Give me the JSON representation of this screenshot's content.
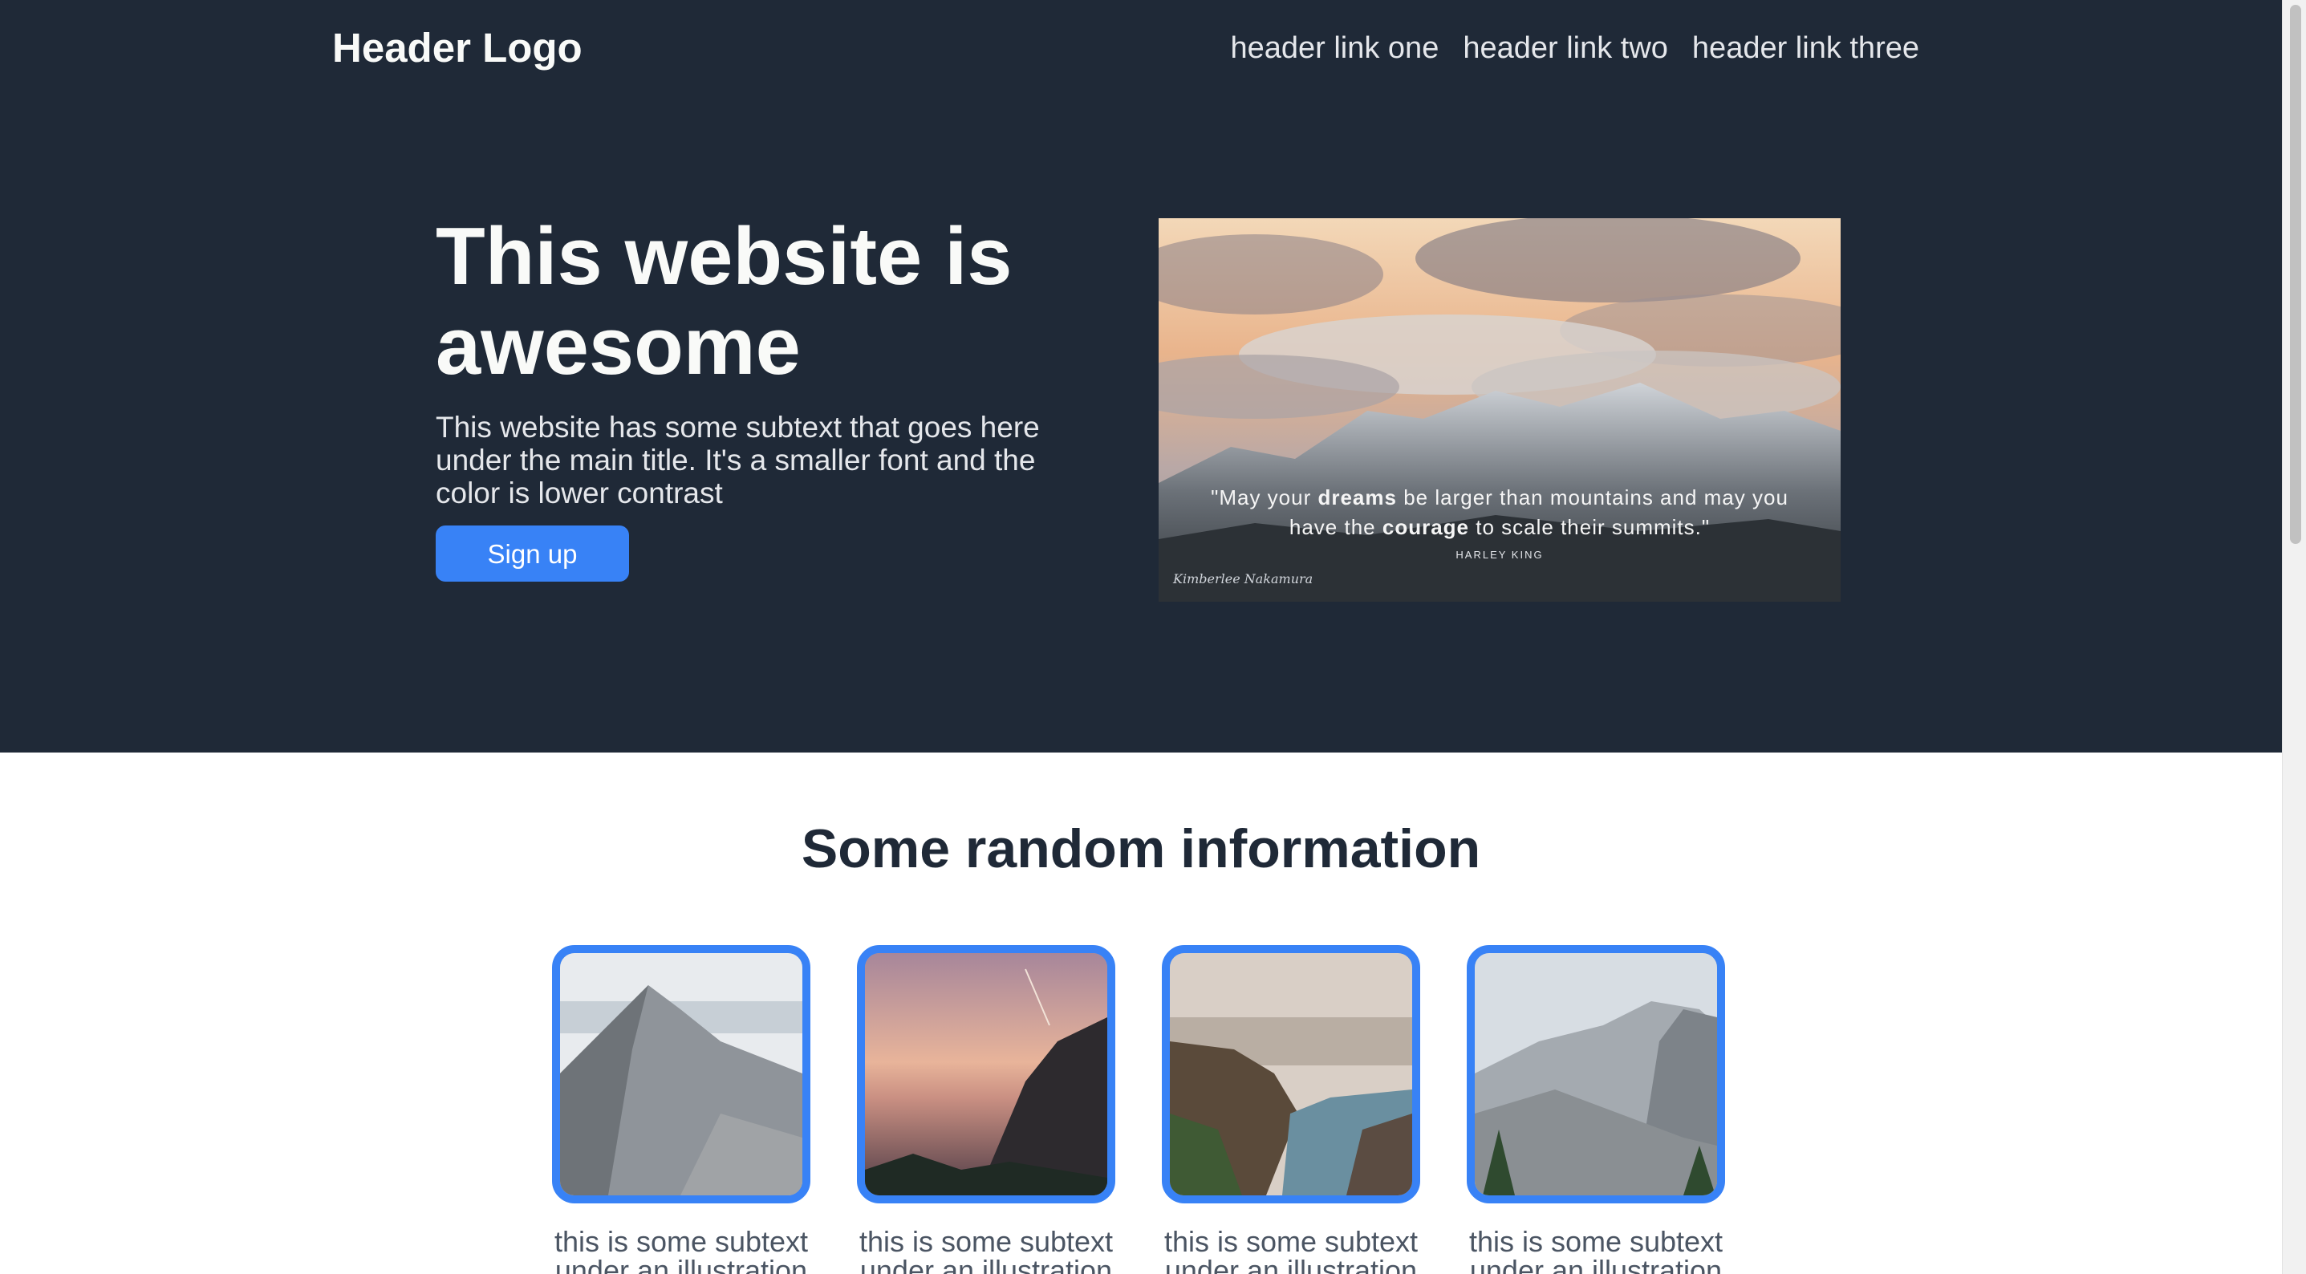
{
  "header": {
    "logo": "Header Logo",
    "links": [
      "header link one",
      "header link two",
      "header link three"
    ]
  },
  "hero": {
    "title": "This website is awesome",
    "subtext": "This website has some subtext that goes here under the main title. It's a smaller font and the color is lower contrast",
    "button_label": "Sign up",
    "image": {
      "quote_part1": "\"May your ",
      "quote_bold1": "dreams",
      "quote_part2": " be larger than mountains and may you have the ",
      "quote_bold2": "courage",
      "quote_part3": " to scale their summits.\"",
      "quote_author": "HARLEY KING",
      "signature": "Kimberlee Nakamura"
    }
  },
  "info": {
    "title": "Some random information",
    "cards": [
      {
        "text": "this is some subtext under an illustration"
      },
      {
        "text": "this is some subtext under an illustration"
      },
      {
        "text": "this is some subtext under an illustration"
      },
      {
        "text": "this is some subtext under an illustration"
      }
    ]
  },
  "colors": {
    "dark_bg": "#1f2937",
    "accent": "#3882f6",
    "light_text": "#f9faf8",
    "muted_text": "#e5e7eb"
  }
}
